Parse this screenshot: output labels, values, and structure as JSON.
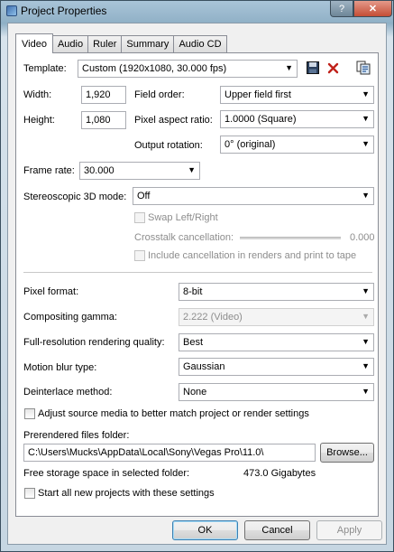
{
  "window": {
    "title": "Project Properties",
    "help": "?",
    "close": "✕"
  },
  "tabs": [
    "Video",
    "Audio",
    "Ruler",
    "Summary",
    "Audio CD"
  ],
  "template": {
    "label": "Template:",
    "value": "Custom (1920x1080, 30.000 fps)"
  },
  "width": {
    "label": "Width:",
    "value": "1,920"
  },
  "height": {
    "label": "Height:",
    "value": "1,080"
  },
  "field_order": {
    "label": "Field order:",
    "value": "Upper field first"
  },
  "pixel_aspect": {
    "label": "Pixel aspect ratio:",
    "value": "1.0000 (Square)"
  },
  "output_rotation": {
    "label": "Output rotation:",
    "value": "0° (original)"
  },
  "frame_rate": {
    "label": "Frame rate:",
    "value": "30.000"
  },
  "stereo": {
    "label": "Stereoscopic 3D mode:",
    "value": "Off"
  },
  "swap": {
    "label": "Swap Left/Right"
  },
  "crosstalk": {
    "label": "Crosstalk cancellation:",
    "value": "0.000"
  },
  "include_cancel": {
    "label": "Include cancellation in renders and print to tape"
  },
  "pixel_format": {
    "label": "Pixel format:",
    "value": "8-bit"
  },
  "gamma": {
    "label": "Compositing gamma:",
    "value": "2.222 (Video)"
  },
  "quality": {
    "label": "Full-resolution rendering quality:",
    "value": "Best"
  },
  "motion_blur": {
    "label": "Motion blur type:",
    "value": "Gaussian"
  },
  "deinterlace": {
    "label": "Deinterlace method:",
    "value": "None"
  },
  "adjust_source": {
    "label": "Adjust source media to better match project or render settings"
  },
  "prerender": {
    "label": "Prerendered files folder:",
    "path": "C:\\Users\\Mucks\\AppData\\Local\\Sony\\Vegas Pro\\11.0\\",
    "browse": "Browse..."
  },
  "storage": {
    "label": "Free storage space in selected folder:",
    "value": "473.0 Gigabytes"
  },
  "start_all": {
    "label": "Start all new projects with these settings"
  },
  "buttons": {
    "ok": "OK",
    "cancel": "Cancel",
    "apply": "Apply"
  },
  "icons": {
    "save": "save-icon",
    "delete": "delete-icon",
    "match_media": "match-media-icon"
  }
}
